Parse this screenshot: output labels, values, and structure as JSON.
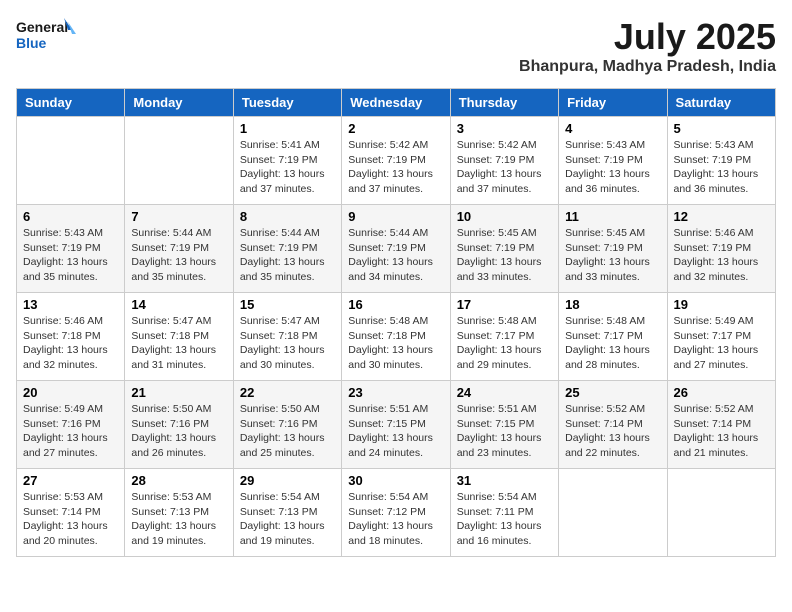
{
  "logo": {
    "line1": "General",
    "line2": "Blue"
  },
  "title": "July 2025",
  "location": "Bhanpura, Madhya Pradesh, India",
  "days_of_week": [
    "Sunday",
    "Monday",
    "Tuesday",
    "Wednesday",
    "Thursday",
    "Friday",
    "Saturday"
  ],
  "weeks": [
    [
      {
        "day": "",
        "info": ""
      },
      {
        "day": "",
        "info": ""
      },
      {
        "day": "1",
        "info": "Sunrise: 5:41 AM\nSunset: 7:19 PM\nDaylight: 13 hours and 37 minutes."
      },
      {
        "day": "2",
        "info": "Sunrise: 5:42 AM\nSunset: 7:19 PM\nDaylight: 13 hours and 37 minutes."
      },
      {
        "day": "3",
        "info": "Sunrise: 5:42 AM\nSunset: 7:19 PM\nDaylight: 13 hours and 37 minutes."
      },
      {
        "day": "4",
        "info": "Sunrise: 5:43 AM\nSunset: 7:19 PM\nDaylight: 13 hours and 36 minutes."
      },
      {
        "day": "5",
        "info": "Sunrise: 5:43 AM\nSunset: 7:19 PM\nDaylight: 13 hours and 36 minutes."
      }
    ],
    [
      {
        "day": "6",
        "info": "Sunrise: 5:43 AM\nSunset: 7:19 PM\nDaylight: 13 hours and 35 minutes."
      },
      {
        "day": "7",
        "info": "Sunrise: 5:44 AM\nSunset: 7:19 PM\nDaylight: 13 hours and 35 minutes."
      },
      {
        "day": "8",
        "info": "Sunrise: 5:44 AM\nSunset: 7:19 PM\nDaylight: 13 hours and 35 minutes."
      },
      {
        "day": "9",
        "info": "Sunrise: 5:44 AM\nSunset: 7:19 PM\nDaylight: 13 hours and 34 minutes."
      },
      {
        "day": "10",
        "info": "Sunrise: 5:45 AM\nSunset: 7:19 PM\nDaylight: 13 hours and 33 minutes."
      },
      {
        "day": "11",
        "info": "Sunrise: 5:45 AM\nSunset: 7:19 PM\nDaylight: 13 hours and 33 minutes."
      },
      {
        "day": "12",
        "info": "Sunrise: 5:46 AM\nSunset: 7:19 PM\nDaylight: 13 hours and 32 minutes."
      }
    ],
    [
      {
        "day": "13",
        "info": "Sunrise: 5:46 AM\nSunset: 7:18 PM\nDaylight: 13 hours and 32 minutes."
      },
      {
        "day": "14",
        "info": "Sunrise: 5:47 AM\nSunset: 7:18 PM\nDaylight: 13 hours and 31 minutes."
      },
      {
        "day": "15",
        "info": "Sunrise: 5:47 AM\nSunset: 7:18 PM\nDaylight: 13 hours and 30 minutes."
      },
      {
        "day": "16",
        "info": "Sunrise: 5:48 AM\nSunset: 7:18 PM\nDaylight: 13 hours and 30 minutes."
      },
      {
        "day": "17",
        "info": "Sunrise: 5:48 AM\nSunset: 7:17 PM\nDaylight: 13 hours and 29 minutes."
      },
      {
        "day": "18",
        "info": "Sunrise: 5:48 AM\nSunset: 7:17 PM\nDaylight: 13 hours and 28 minutes."
      },
      {
        "day": "19",
        "info": "Sunrise: 5:49 AM\nSunset: 7:17 PM\nDaylight: 13 hours and 27 minutes."
      }
    ],
    [
      {
        "day": "20",
        "info": "Sunrise: 5:49 AM\nSunset: 7:16 PM\nDaylight: 13 hours and 27 minutes."
      },
      {
        "day": "21",
        "info": "Sunrise: 5:50 AM\nSunset: 7:16 PM\nDaylight: 13 hours and 26 minutes."
      },
      {
        "day": "22",
        "info": "Sunrise: 5:50 AM\nSunset: 7:16 PM\nDaylight: 13 hours and 25 minutes."
      },
      {
        "day": "23",
        "info": "Sunrise: 5:51 AM\nSunset: 7:15 PM\nDaylight: 13 hours and 24 minutes."
      },
      {
        "day": "24",
        "info": "Sunrise: 5:51 AM\nSunset: 7:15 PM\nDaylight: 13 hours and 23 minutes."
      },
      {
        "day": "25",
        "info": "Sunrise: 5:52 AM\nSunset: 7:14 PM\nDaylight: 13 hours and 22 minutes."
      },
      {
        "day": "26",
        "info": "Sunrise: 5:52 AM\nSunset: 7:14 PM\nDaylight: 13 hours and 21 minutes."
      }
    ],
    [
      {
        "day": "27",
        "info": "Sunrise: 5:53 AM\nSunset: 7:14 PM\nDaylight: 13 hours and 20 minutes."
      },
      {
        "day": "28",
        "info": "Sunrise: 5:53 AM\nSunset: 7:13 PM\nDaylight: 13 hours and 19 minutes."
      },
      {
        "day": "29",
        "info": "Sunrise: 5:54 AM\nSunset: 7:13 PM\nDaylight: 13 hours and 19 minutes."
      },
      {
        "day": "30",
        "info": "Sunrise: 5:54 AM\nSunset: 7:12 PM\nDaylight: 13 hours and 18 minutes."
      },
      {
        "day": "31",
        "info": "Sunrise: 5:54 AM\nSunset: 7:11 PM\nDaylight: 13 hours and 16 minutes."
      },
      {
        "day": "",
        "info": ""
      },
      {
        "day": "",
        "info": ""
      }
    ]
  ]
}
